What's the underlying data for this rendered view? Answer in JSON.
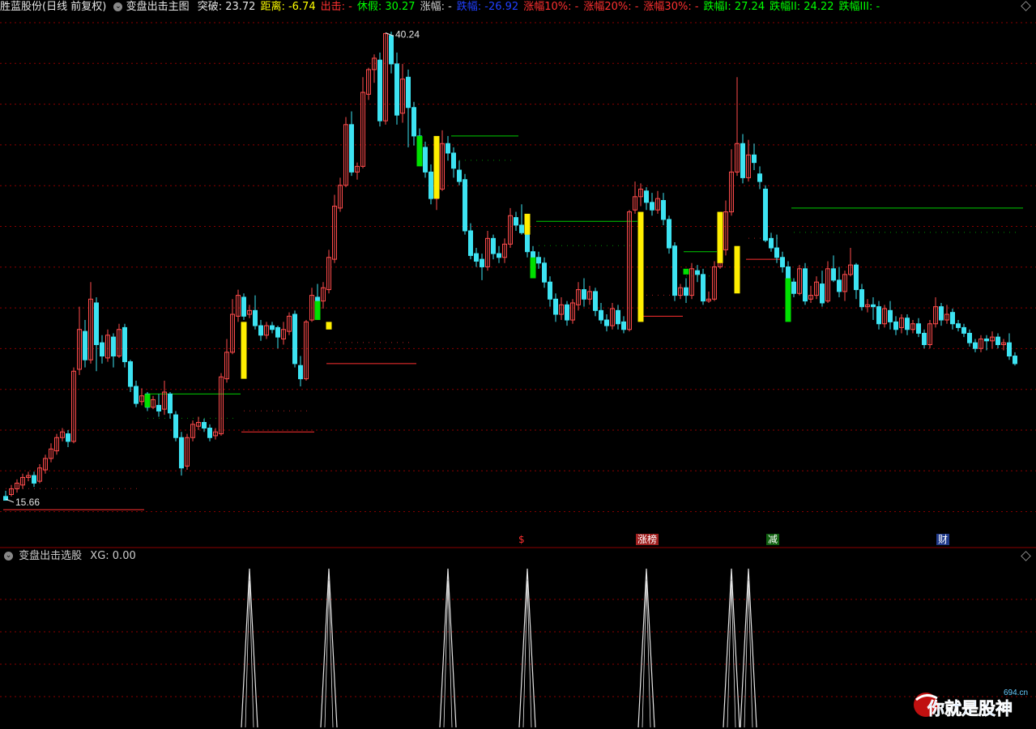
{
  "header": {
    "stock_name": "胜蓝股份(日线 前复权)",
    "indicator_name": "变盘出击主图",
    "items": [
      {
        "label": "突破: 23.72",
        "color": "#e6e6e6"
      },
      {
        "label": "距离: -6.74",
        "color": "#ffff00"
      },
      {
        "label": "出击: -",
        "color": "#ff3030"
      },
      {
        "label": "休假: 30.27",
        "color": "#00ff00"
      },
      {
        "label": "涨幅: -",
        "color": "#d0d0d0"
      },
      {
        "label": "跌幅: -26.92",
        "color": "#2040ff"
      },
      {
        "label": "涨幅10%: -",
        "color": "#ff3030"
      },
      {
        "label": "涨幅20%: -",
        "color": "#ff3030"
      },
      {
        "label": "涨幅30%: -",
        "color": "#ff3030"
      },
      {
        "label": "跌幅I: 27.24",
        "color": "#00ff00"
      },
      {
        "label": "跌幅II: 24.22",
        "color": "#00ff00"
      },
      {
        "label": "跌幅III: -",
        "color": "#00ff00"
      }
    ]
  },
  "sub_header": {
    "indicator_name": "变盘出击选股",
    "value_label": "XG: 0.00"
  },
  "markers": [
    {
      "text": "$",
      "color": "#ff3030",
      "bg": "#000000",
      "x_index": 91
    },
    {
      "text": "涨榜",
      "color": "#ffffff",
      "bg": "#a02020",
      "x_index": 112
    },
    {
      "text": "减",
      "color": "#ffffff",
      "bg": "#106010",
      "x_index": 135
    },
    {
      "text": "财",
      "color": "#ffffff",
      "bg": "#203a8a",
      "x_index": 165
    }
  ],
  "watermark": {
    "text": "你就是股神",
    "site": "694.cn"
  },
  "colors": {
    "up": "#ff4c4c",
    "down": "#3de3f2",
    "signal_yellow": "#ffee00",
    "signal_green": "#00e000",
    "grid": "#8b0000"
  },
  "chart_data": {
    "type": "candlestick",
    "annotations": [
      {
        "text": "40.24",
        "x_index": 67,
        "y": 40.24
      },
      {
        "text": "15.66",
        "x_index": 0,
        "y": 15.66
      }
    ],
    "ylim": [
      14.0,
      41.2
    ],
    "candles": [
      [
        15.8,
        15.6,
        16.1,
        15.66
      ],
      [
        15.9,
        16.2,
        16.4,
        15.8
      ],
      [
        16.2,
        16.5,
        16.7,
        16.0
      ],
      [
        16.4,
        16.8,
        17.0,
        16.2
      ],
      [
        16.8,
        16.9,
        17.1,
        16.6
      ],
      [
        16.9,
        16.5,
        17.1,
        16.3
      ],
      [
        16.6,
        17.3,
        17.5,
        16.5
      ],
      [
        17.2,
        17.8,
        18.0,
        17.0
      ],
      [
        17.8,
        18.3,
        18.6,
        17.6
      ],
      [
        18.2,
        18.9,
        19.1,
        18.0
      ],
      [
        18.9,
        19.2,
        19.4,
        18.7
      ],
      [
        19.1,
        18.7,
        19.3,
        18.4
      ],
      [
        18.7,
        22.4,
        22.6,
        18.6
      ],
      [
        22.5,
        24.6,
        25.8,
        22.2
      ],
      [
        24.5,
        23.0,
        25.1,
        22.6
      ],
      [
        23.0,
        26.2,
        27.1,
        22.8
      ],
      [
        26.0,
        23.8,
        26.3,
        22.4
      ],
      [
        23.9,
        23.2,
        24.3,
        22.8
      ],
      [
        23.1,
        24.3,
        24.6,
        22.9
      ],
      [
        24.2,
        23.2,
        24.4,
        22.6
      ],
      [
        23.2,
        24.6,
        24.9,
        23.1
      ],
      [
        24.7,
        22.9,
        24.9,
        22.6
      ],
      [
        22.9,
        21.6,
        23.0,
        21.3
      ],
      [
        21.6,
        20.7,
        21.9,
        20.5
      ],
      [
        20.8,
        21.1,
        21.5,
        20.6
      ],
      [
        21.2,
        20.5,
        21.3,
        20.3
      ],
      [
        20.5,
        20.9,
        21.1,
        20.4
      ],
      [
        20.6,
        20.3,
        21.2,
        20.0
      ],
      [
        20.4,
        21.3,
        21.9,
        20.1
      ],
      [
        21.2,
        20.2,
        21.3,
        19.9
      ],
      [
        20.1,
        18.9,
        20.3,
        18.7
      ],
      [
        18.9,
        17.3,
        19.2,
        16.9
      ],
      [
        17.4,
        18.9,
        19.1,
        17.2
      ],
      [
        18.9,
        19.6,
        19.8,
        18.7
      ],
      [
        19.5,
        19.7,
        20.0,
        19.3
      ],
      [
        19.7,
        19.4,
        19.9,
        19.2
      ],
      [
        19.4,
        18.9,
        19.6,
        18.7
      ],
      [
        19.0,
        19.2,
        19.4,
        18.8
      ],
      [
        19.1,
        22.1,
        22.3,
        19.0
      ],
      [
        22.0,
        23.4,
        24.1,
        21.8
      ],
      [
        23.4,
        25.4,
        26.2,
        23.3
      ],
      [
        25.3,
        26.4,
        26.7,
        25.0
      ],
      [
        26.3,
        25.3,
        26.5,
        25.1
      ],
      [
        25.4,
        25.6,
        25.9,
        25.2
      ],
      [
        25.6,
        24.8,
        26.4,
        24.6
      ],
      [
        24.8,
        24.3,
        25.1,
        24.0
      ],
      [
        24.3,
        24.8,
        25.0,
        24.1
      ],
      [
        24.8,
        24.6,
        25.0,
        24.4
      ],
      [
        24.7,
        24.2,
        24.8,
        23.6
      ],
      [
        24.1,
        24.6,
        25.0,
        23.8
      ],
      [
        24.5,
        25.3,
        25.5,
        24.3
      ],
      [
        25.4,
        22.8,
        25.6,
        22.6
      ],
      [
        22.7,
        22.0,
        23.2,
        21.6
      ],
      [
        22.0,
        25.0,
        25.1,
        21.9
      ],
      [
        25.1,
        26.4,
        26.8,
        25.0
      ],
      [
        26.3,
        26.1,
        27.0,
        25.6
      ],
      [
        26.1,
        26.8,
        27.1,
        25.7
      ],
      [
        26.7,
        28.4,
        28.8,
        26.5
      ],
      [
        28.3,
        31.1,
        31.7,
        28.1
      ],
      [
        31.0,
        32.2,
        32.6,
        30.8
      ],
      [
        32.2,
        35.4,
        35.8,
        32.1
      ],
      [
        35.4,
        32.9,
        36.1,
        32.7
      ],
      [
        32.9,
        33.2,
        33.4,
        32.5
      ],
      [
        33.2,
        37.1,
        37.9,
        33.1
      ],
      [
        37.0,
        38.3,
        38.4,
        36.7
      ],
      [
        38.3,
        38.9,
        39.1,
        37.6
      ],
      [
        38.8,
        35.6,
        39.2,
        35.3
      ],
      [
        35.6,
        40.2,
        40.24,
        35.4
      ],
      [
        40.1,
        38.6,
        40.3,
        38.1
      ],
      [
        38.6,
        35.9,
        39.2,
        35.4
      ],
      [
        36.0,
        37.8,
        38.6,
        35.5
      ],
      [
        37.9,
        36.3,
        38.3,
        34.2
      ],
      [
        36.3,
        34.8,
        36.6,
        34.3
      ],
      [
        34.8,
        34.2,
        35.2,
        33.8
      ],
      [
        34.2,
        32.9,
        34.5,
        32.6
      ],
      [
        32.9,
        31.5,
        33.3,
        31.2
      ],
      [
        31.5,
        32.1,
        32.4,
        30.9
      ],
      [
        32.0,
        34.4,
        35.1,
        31.9
      ],
      [
        34.4,
        33.9,
        34.8,
        33.5
      ],
      [
        33.9,
        33.1,
        34.2,
        32.6
      ],
      [
        33.0,
        32.4,
        33.5,
        32.2
      ],
      [
        32.5,
        29.8,
        32.8,
        29.6
      ],
      [
        29.8,
        28.5,
        30.2,
        28.3
      ],
      [
        28.6,
        28.2,
        28.9,
        27.9
      ],
      [
        28.3,
        27.9,
        28.6,
        27.2
      ],
      [
        27.9,
        29.4,
        29.8,
        27.7
      ],
      [
        29.4,
        28.6,
        29.6,
        28.3
      ],
      [
        28.6,
        28.4,
        29.0,
        28.1
      ],
      [
        28.4,
        29.1,
        29.4,
        28.1
      ],
      [
        29.1,
        30.6,
        31.0,
        28.9
      ],
      [
        30.5,
        30.1,
        30.8,
        29.8
      ],
      [
        30.1,
        29.7,
        31.2,
        29.6
      ],
      [
        29.7,
        28.7,
        30.1,
        28.4
      ],
      [
        28.7,
        28.4,
        29.0,
        28.1
      ],
      [
        28.4,
        28.1,
        28.7,
        27.8
      ],
      [
        28.1,
        27.1,
        28.4,
        26.8
      ],
      [
        27.1,
        26.2,
        27.4,
        25.8
      ],
      [
        26.2,
        25.4,
        26.5,
        25.0
      ],
      [
        25.4,
        25.9,
        26.3,
        25.1
      ],
      [
        25.9,
        25.1,
        26.1,
        24.8
      ],
      [
        25.1,
        26.0,
        26.2,
        24.9
      ],
      [
        25.9,
        26.7,
        27.1,
        25.6
      ],
      [
        26.7,
        26.2,
        27.3,
        25.8
      ],
      [
        26.2,
        26.6,
        26.9,
        25.9
      ],
      [
        26.6,
        25.6,
        26.8,
        25.3
      ],
      [
        25.6,
        25.1,
        26.0,
        24.9
      ],
      [
        25.1,
        24.8,
        25.4,
        24.5
      ],
      [
        24.8,
        25.7,
        26.0,
        24.6
      ],
      [
        25.6,
        24.9,
        25.9,
        24.6
      ],
      [
        25.0,
        24.6,
        25.3,
        24.4
      ],
      [
        24.6,
        30.8,
        30.9,
        24.5
      ],
      [
        30.9,
        31.6,
        32.4,
        30.7
      ],
      [
        31.6,
        32.0,
        32.3,
        31.1
      ],
      [
        31.9,
        31.3,
        32.1,
        30.9
      ],
      [
        31.3,
        30.9,
        31.8,
        30.6
      ],
      [
        30.9,
        31.5,
        31.9,
        30.7
      ],
      [
        31.4,
        30.4,
        31.8,
        30.1
      ],
      [
        30.4,
        28.9,
        30.6,
        28.6
      ],
      [
        29.0,
        26.4,
        29.2,
        26.1
      ],
      [
        26.4,
        26.8,
        27.0,
        26.2
      ],
      [
        26.8,
        26.4,
        27.3,
        26.0
      ],
      [
        26.4,
        27.8,
        28.1,
        26.2
      ],
      [
        27.7,
        27.5,
        28.0,
        27.1
      ],
      [
        27.5,
        26.1,
        27.8,
        25.9
      ],
      [
        26.1,
        26.2,
        26.6,
        26.0
      ],
      [
        26.2,
        27.9,
        28.2,
        26.1
      ],
      [
        27.9,
        28.9,
        29.4,
        27.8
      ],
      [
        28.8,
        30.8,
        31.4,
        28.5
      ],
      [
        30.8,
        32.9,
        34.1,
        30.6
      ],
      [
        32.9,
        34.4,
        37.9,
        32.7
      ],
      [
        34.4,
        32.6,
        34.9,
        32.3
      ],
      [
        32.6,
        33.8,
        34.6,
        32.4
      ],
      [
        33.8,
        33.4,
        34.4,
        33.0
      ],
      [
        32.8,
        32.4,
        33.2,
        32.0
      ],
      [
        32.0,
        29.3,
        32.2,
        29.2
      ],
      [
        29.4,
        28.9,
        29.7,
        28.7
      ],
      [
        28.9,
        28.4,
        29.6,
        28.1
      ],
      [
        28.4,
        27.9,
        28.7,
        27.6
      ],
      [
        27.9,
        27.1,
        28.2,
        26.8
      ],
      [
        27.1,
        26.5,
        27.3,
        26.3
      ],
      [
        26.5,
        27.8,
        28.0,
        26.4
      ],
      [
        27.8,
        26.1,
        28.1,
        25.9
      ],
      [
        26.2,
        26.4,
        26.9,
        26.0
      ],
      [
        26.4,
        27.1,
        27.4,
        26.2
      ],
      [
        27.0,
        26.0,
        27.7,
        25.8
      ],
      [
        26.1,
        27.8,
        28.2,
        26.0
      ],
      [
        27.8,
        27.2,
        28.5,
        27.1
      ],
      [
        27.2,
        26.6,
        27.9,
        26.3
      ],
      [
        26.6,
        27.5,
        27.7,
        26.1
      ],
      [
        27.5,
        28.0,
        28.9,
        27.4
      ],
      [
        28.0,
        26.7,
        28.1,
        26.2
      ],
      [
        26.7,
        25.8,
        27.0,
        25.6
      ],
      [
        25.8,
        25.9,
        26.2,
        25.5
      ],
      [
        25.9,
        25.8,
        26.3,
        25.1
      ],
      [
        25.8,
        24.9,
        26.1,
        24.6
      ],
      [
        24.9,
        25.7,
        25.9,
        24.7
      ],
      [
        25.6,
        25.0,
        26.1,
        24.6
      ],
      [
        25.0,
        24.6,
        25.3,
        24.3
      ],
      [
        24.7,
        25.2,
        25.4,
        24.4
      ],
      [
        25.2,
        24.6,
        25.4,
        24.3
      ],
      [
        24.6,
        24.9,
        25.1,
        24.4
      ],
      [
        24.9,
        24.4,
        25.2,
        24.2
      ],
      [
        24.4,
        23.8,
        24.6,
        23.6
      ],
      [
        23.8,
        24.9,
        25.1,
        23.6
      ],
      [
        24.9,
        25.8,
        26.3,
        24.7
      ],
      [
        25.8,
        25.1,
        26.0,
        24.8
      ],
      [
        25.1,
        25.4,
        25.9,
        24.9
      ],
      [
        25.5,
        24.9,
        25.7,
        24.6
      ],
      [
        24.9,
        24.7,
        25.1,
        24.5
      ],
      [
        24.7,
        24.4,
        24.9,
        24.2
      ],
      [
        24.4,
        23.9,
        24.6,
        23.7
      ],
      [
        23.9,
        23.6,
        24.1,
        23.4
      ],
      [
        23.6,
        24.1,
        24.3,
        23.4
      ],
      [
        24.1,
        24.0,
        24.3,
        23.5
      ],
      [
        24.0,
        24.2,
        24.5,
        23.6
      ],
      [
        24.2,
        23.8,
        24.4,
        23.6
      ],
      [
        23.8,
        23.9,
        24.1,
        23.5
      ],
      [
        23.9,
        23.2,
        24.4,
        23.0
      ],
      [
        23.2,
        22.8,
        23.4,
        22.7
      ]
    ],
    "signal_bars": [
      {
        "x_index": 25,
        "type": "green",
        "range": [
          21.2,
          20.5
        ]
      },
      {
        "x_index": 42,
        "type": "yellow",
        "range": [
          22.0,
          25.0
        ]
      },
      {
        "x_index": 55,
        "type": "green",
        "range": [
          26.1,
          25.1
        ]
      },
      {
        "x_index": 57,
        "type": "yellow",
        "range": [
          24.6,
          25.0
        ]
      },
      {
        "x_index": 73,
        "type": "green",
        "range": [
          34.8,
          33.2
        ]
      },
      {
        "x_index": 76,
        "type": "yellow",
        "range": [
          31.5,
          34.8
        ]
      },
      {
        "x_index": 92,
        "type": "yellow",
        "range": [
          30.7,
          29.6
        ]
      },
      {
        "x_index": 93,
        "type": "green",
        "range": [
          28.4,
          27.3
        ]
      },
      {
        "x_index": 112,
        "type": "yellow",
        "range": [
          25.0,
          30.8
        ]
      },
      {
        "x_index": 120,
        "type": "green",
        "range": [
          27.5,
          27.8
        ]
      },
      {
        "x_index": 126,
        "type": "yellow",
        "range": [
          30.8,
          28.1
        ]
      },
      {
        "x_index": 129,
        "type": "yellow",
        "range": [
          29.0,
          26.5
        ]
      },
      {
        "x_index": 138,
        "type": "green",
        "range": [
          27.3,
          25.0
        ]
      }
    ],
    "level_lines": [
      {
        "y": 15.1,
        "from": 0,
        "to": 24,
        "color": "#ff3030"
      },
      {
        "y": 21.2,
        "from": 25,
        "to": 41,
        "color": "#00cc00"
      },
      {
        "y": 19.2,
        "from": 42,
        "to": 54,
        "color": "#ff3030"
      },
      {
        "y": 22.8,
        "from": 57,
        "to": 72,
        "color": "#ff3030"
      },
      {
        "y": 34.8,
        "from": 79,
        "to": 90,
        "color": "#00cc00"
      },
      {
        "y": 30.3,
        "from": 94,
        "to": 111,
        "color": "#00cc00"
      },
      {
        "y": 25.3,
        "from": 112,
        "to": 119,
        "color": "#ff3030"
      },
      {
        "y": 28.7,
        "from": 120,
        "to": 125,
        "color": "#00cc00"
      },
      {
        "y": 28.3,
        "from": 131,
        "to": 137,
        "color": "#ff3030"
      },
      {
        "y": 31.0,
        "from": 139,
        "to": 179,
        "color": "#00cc00"
      }
    ],
    "sub_chart": {
      "type": "spikes",
      "ylim": [
        0,
        1
      ],
      "spike_indices": [
        43,
        57,
        78,
        92,
        113,
        128,
        131
      ]
    }
  }
}
